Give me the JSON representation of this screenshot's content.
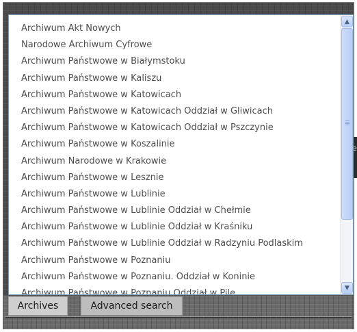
{
  "dropdown": {
    "items": [
      "Archiwum Akt Nowych",
      "Narodowe Archiwum Cyfrowe",
      "Archiwum Państwowe w Białymstoku",
      "Archiwum Państwowe w Kaliszu",
      "Archiwum Państwowe w Katowicach",
      "Archiwum Państwowe w Katowicach Oddział w Gliwicach",
      "Archiwum Państwowe w Katowicach Oddział w Pszczynie",
      "Archiwum Państwowe w Koszalinie",
      "Archiwum Narodowe w Krakowie",
      "Archiwum Państwowe w Lesznie",
      "Archiwum Państwowe w Lublinie",
      "Archiwum Państwowe w Lublinie Oddział w Chełmie",
      "Archiwum Państwowe w Lublinie Oddział w Kraśniku",
      "Archiwum Państwowe w Lublinie Oddział w Radzyniu Podlaskim",
      "Archiwum Państwowe w Poznaniu",
      "Archiwum Państwowe w Poznaniu. Oddział w Koninie",
      "Archiwum Państwowe w Poznaniu Oddział w Pile"
    ],
    "scroll_up_icon": "chevron-up-icon",
    "scroll_down_icon": "chevron-down-icon"
  },
  "tabs": {
    "archives_label": "Archives",
    "advanced_search_label": "Advanced search"
  },
  "background": {
    "side_label": "e"
  }
}
